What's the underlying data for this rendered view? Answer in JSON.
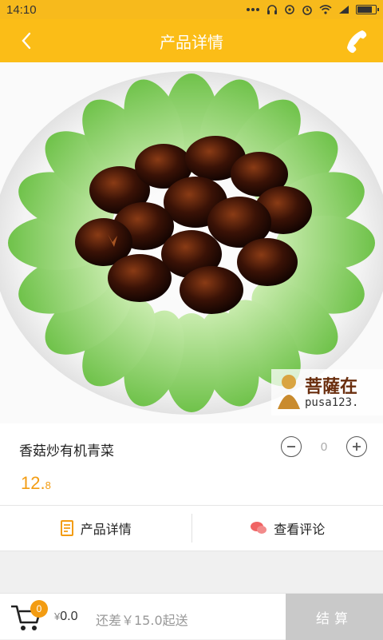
{
  "status_bar": {
    "time": "14:10"
  },
  "header": {
    "title": "产品详情",
    "back_icon": "chevron-left-icon",
    "phone_icon": "phone-icon"
  },
  "photo": {
    "watermark_text": "菩薩在",
    "watermark_url": "pusa123."
  },
  "product": {
    "name": "香菇炒有机青菜",
    "price_int": "12.",
    "price_dec": "8",
    "quantity": "0"
  },
  "tabs": [
    {
      "label": "产品详情",
      "icon": "document-icon"
    },
    {
      "label": "查看评论",
      "icon": "chat-bubble-icon"
    }
  ],
  "cart": {
    "badge_count": "0",
    "currency": "¥",
    "total": "0.0",
    "shortfall_text": "还差￥15.0起送",
    "checkout_label": "结算"
  },
  "colors": {
    "accent": "#fbbd17",
    "price": "#f39c12",
    "checkout_disabled": "#c9c9c9"
  }
}
